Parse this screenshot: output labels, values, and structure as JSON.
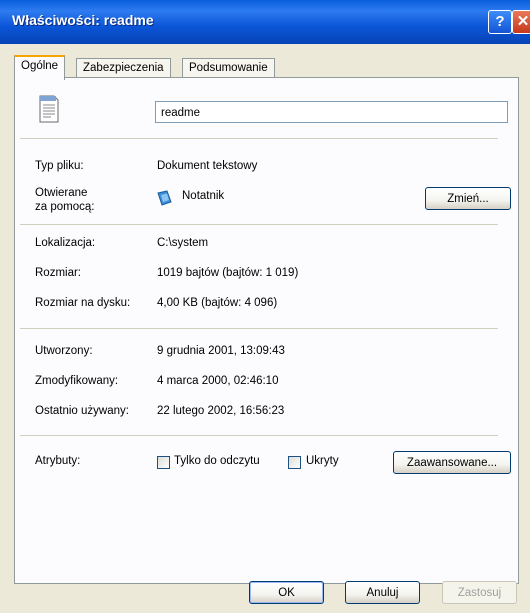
{
  "window": {
    "title": "Właściwości: readme"
  },
  "tabs": [
    {
      "label": "Ogólne"
    },
    {
      "label": "Zabezpieczenia"
    },
    {
      "label": "Podsumowanie"
    }
  ],
  "general": {
    "file_name": "readme",
    "icon": "notepad-document-icon",
    "type_label": "Typ pliku:",
    "type_value": "Dokument tekstowy",
    "opens_label_1": "Otwierane",
    "opens_label_2": "za pomocą:",
    "opens_app": "Notatnik",
    "app_icon": "notepad-icon",
    "change_button": "Zmień...",
    "location_label": "Lokalizacja:",
    "location_value": "C:\\system",
    "size_label": "Rozmiar:",
    "size_value": "1019 bajtów (bajtów: 1 019)",
    "disk_size_label": "Rozmiar na dysku:",
    "disk_size_value": "4,00 KB (bajtów: 4 096)",
    "created_label": "Utworzony:",
    "created_value": "9 grudnia 2001, 13:09:43",
    "modified_label": "Zmodyfikowany:",
    "modified_value": "4 marca 2000, 02:46:10",
    "accessed_label": "Ostatnio używany:",
    "accessed_value": "22 lutego 2002, 16:56:23",
    "attributes_label": "Atrybuty:",
    "readonly_label": "Tylko do odczytu",
    "readonly_checked": false,
    "hidden_label": "Ukryty",
    "hidden_checked": false,
    "advanced_button": "Zaawansowane..."
  },
  "footer": {
    "ok": "OK",
    "cancel": "Anuluj",
    "apply": "Zastosuj"
  }
}
